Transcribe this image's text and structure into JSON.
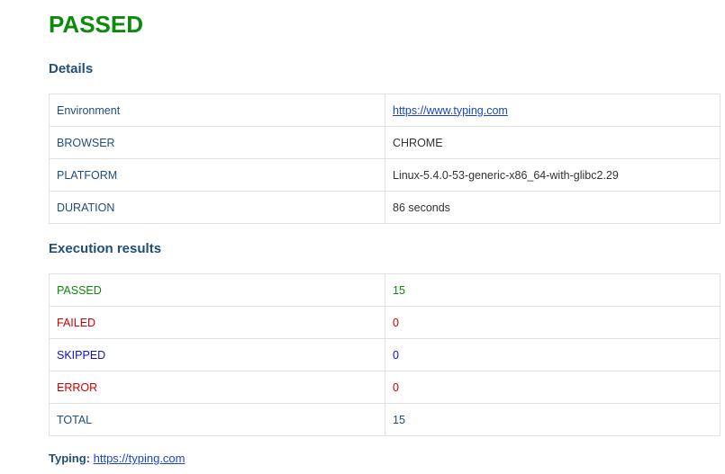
{
  "status": "PASSED",
  "details": {
    "title": "Details",
    "rows": [
      {
        "key": "Environment",
        "value": "https://www.typing.com"
      },
      {
        "key": "BROWSER",
        "value": "CHROME"
      },
      {
        "key": "PLATFORM",
        "value": "Linux-5.4.0-53-generic-x86_64-with-glibc2.29"
      },
      {
        "key": "DURATION",
        "value": "86 seconds"
      }
    ]
  },
  "results": {
    "title": "Execution results",
    "rows": [
      {
        "key": "PASSED",
        "value": "15",
        "color": "#0b8a0b"
      },
      {
        "key": "FAILED",
        "value": "0",
        "color": "#d00000"
      },
      {
        "key": "SKIPPED",
        "value": "0",
        "color": "#1010c8"
      },
      {
        "key": "ERROR",
        "value": "0",
        "color": "#d00000"
      },
      {
        "key": "TOTAL",
        "value": "15",
        "color": "#1f4e79"
      }
    ]
  },
  "footer": {
    "label": "Typing:",
    "link": "https://typing.com"
  },
  "colors": {
    "passed": "#0b8a0b",
    "heading": "#1f4e79",
    "link": "#1a44c8"
  }
}
